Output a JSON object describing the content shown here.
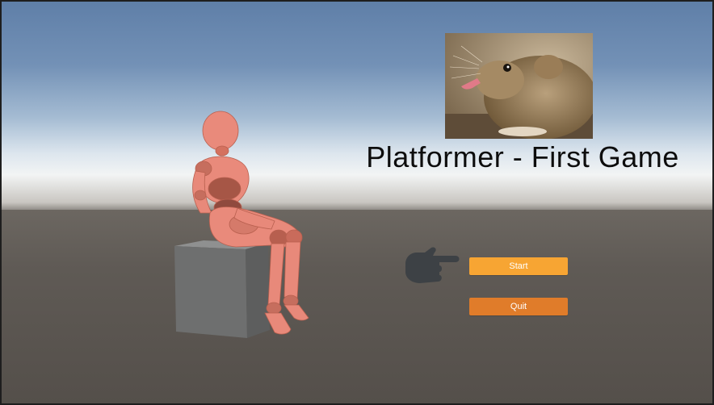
{
  "game": {
    "title": "Platformer - First Game"
  },
  "menu": {
    "start_label": "Start",
    "quit_label": "Quit",
    "start_color": "#f7a533",
    "quit_color": "#e07c2a"
  },
  "scene": {
    "character_color": "#e8897a",
    "crate_color": "#6f7070",
    "pointer_icon": "pointing-hand-icon",
    "photo": "mouse-photo"
  }
}
